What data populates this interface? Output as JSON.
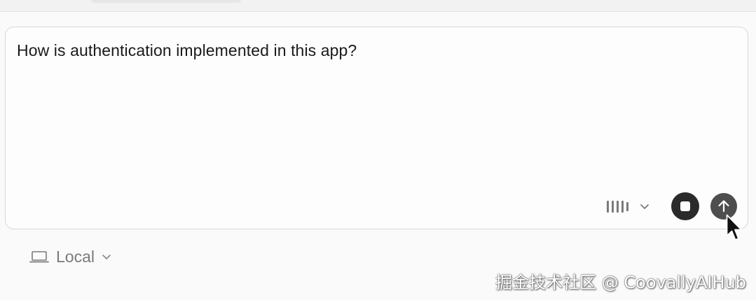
{
  "composer": {
    "prompt": "How is authentication implemented in this app?",
    "voice_icon": "waveform-icon",
    "dropdown_icon": "chevron-down-icon",
    "stop_icon": "stop-icon",
    "send_icon": "arrow-up-icon"
  },
  "environment": {
    "icon": "laptop-icon",
    "label": "Local",
    "dropdown_icon": "chevron-down-icon"
  },
  "watermark": {
    "text": "掘金技术社区 @ CoovallyAIHub"
  },
  "colors": {
    "background": "#fafafa",
    "composer_border": "#d8d8d8",
    "stop_button": "#2a2a2a",
    "send_button": "#4e4e4e",
    "muted_text": "#7a7a7a"
  }
}
